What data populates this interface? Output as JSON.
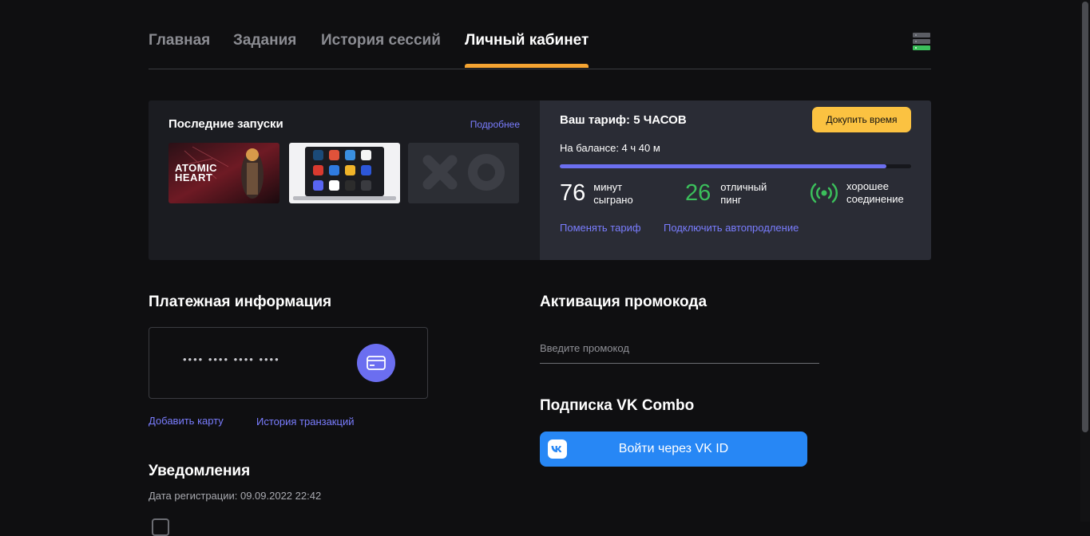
{
  "nav": {
    "tabs": [
      {
        "label": "Главная"
      },
      {
        "label": "Задания"
      },
      {
        "label": "История сессий"
      },
      {
        "label": "Личный кабинет",
        "active": true
      }
    ],
    "server_icon": "server-status-icon",
    "accent_color": "#f5a432"
  },
  "launches": {
    "title": "Последние запуски",
    "more_link": "Подробнее",
    "thumbnails": [
      {
        "name": "Atomic Heart",
        "caption": "ATOMIC HEART"
      },
      {
        "name": "launcher-apps-laptop"
      },
      {
        "name": "placeholder-logo"
      }
    ]
  },
  "tariff": {
    "title": "Ваш тариф: 5 ЧАСОВ",
    "buy_button": "Докупить время",
    "balance": "На балансе: 4 ч 40 м",
    "progress": 0.93,
    "stats": [
      {
        "value": "76",
        "label_line1": "минут",
        "label_line2": "сыграно",
        "color": "#ffffff"
      },
      {
        "value": "26",
        "label_line1": "отличный",
        "label_line2": "пинг",
        "color": "#3bbf5b"
      },
      {
        "icon": "signal-broadcast-icon",
        "label_line1": "хорошее",
        "label_line2": "соединение",
        "color": "#3bbf5b"
      }
    ],
    "change_link": "Поменять тариф",
    "autorenew_link": "Подключить автопродление"
  },
  "payment": {
    "title": "Платежная информация",
    "card_mask": "•••• •••• •••• ••••",
    "card_icon": "credit-card-icon",
    "add_card": "Добавить карту",
    "history": "История транзакций"
  },
  "promo": {
    "title": "Активация промокода",
    "placeholder": "Введите промокод",
    "value": ""
  },
  "vk": {
    "title": "Подписка VK Combo",
    "button": "Войти через VK ID",
    "color": "#2787f5"
  },
  "notifications": {
    "title": "Уведомления",
    "reg_date": "Дата регистрации: 09.09.2022 22:42"
  }
}
